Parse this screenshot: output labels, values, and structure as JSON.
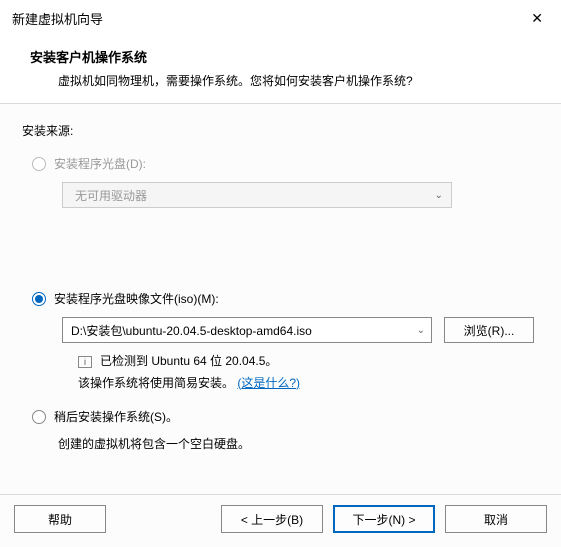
{
  "window": {
    "title": "新建虚拟机向导"
  },
  "header": {
    "heading": "安装客户机操作系统",
    "subtitle": "虚拟机如同物理机，需要操作系统。您将如何安装客户机操作系统?"
  },
  "source": {
    "label": "安装来源:",
    "disc": {
      "label": "安装程序光盘(D):",
      "dropdown_value": "无可用驱动器"
    },
    "iso": {
      "label": "安装程序光盘映像文件(iso)(M):",
      "path": "D:\\安装包\\ubuntu-20.04.5-desktop-amd64.iso",
      "browse": "浏览(R)...",
      "detect_line1": "已检测到 Ubuntu 64 位 20.04.5。",
      "detect_line2_a": "该操作系统将使用简易安装。",
      "detect_link": "(这是什么?)"
    },
    "later": {
      "label": "稍后安装操作系统(S)。",
      "desc": "创建的虚拟机将包含一个空白硬盘。"
    }
  },
  "footer": {
    "help": "帮助",
    "back": "< 上一步(B)",
    "next": "下一步(N) >",
    "cancel": "取消"
  }
}
